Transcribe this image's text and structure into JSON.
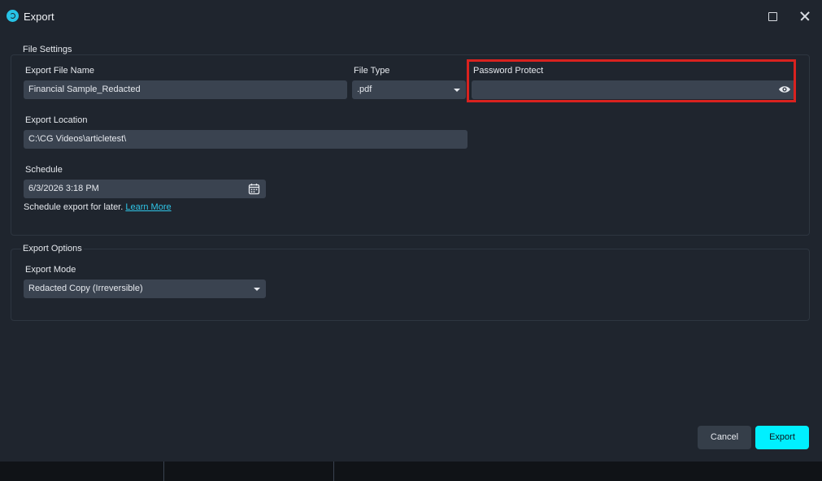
{
  "window": {
    "title": "Export"
  },
  "file_settings": {
    "group_title": "File Settings",
    "file_name_label": "Export File Name",
    "file_name_value": "Financial Sample_Redacted",
    "file_type_label": "File Type",
    "file_type_value": ".pdf",
    "password_label": "Password Protect",
    "password_value": "",
    "location_label": "Export Location",
    "location_value": "C:\\CG Videos\\articletest\\",
    "schedule_label": "Schedule",
    "schedule_value": "6/3/2026 3:18 PM",
    "schedule_note": "Schedule export for later.",
    "learn_more": "Learn More"
  },
  "export_options": {
    "group_title": "Export Options",
    "mode_label": "Export Mode",
    "mode_value": "Redacted Copy (Irreversible)"
  },
  "buttons": {
    "cancel": "Cancel",
    "export": "Export"
  },
  "colors": {
    "accent": "#00f0ff",
    "highlight": "#d9221f",
    "link": "#2fc6e8"
  },
  "icons": [
    "app-logo-icon",
    "maximize-icon",
    "close-icon",
    "eye-icon",
    "calendar-icon",
    "dropdown-arrow-icon"
  ]
}
